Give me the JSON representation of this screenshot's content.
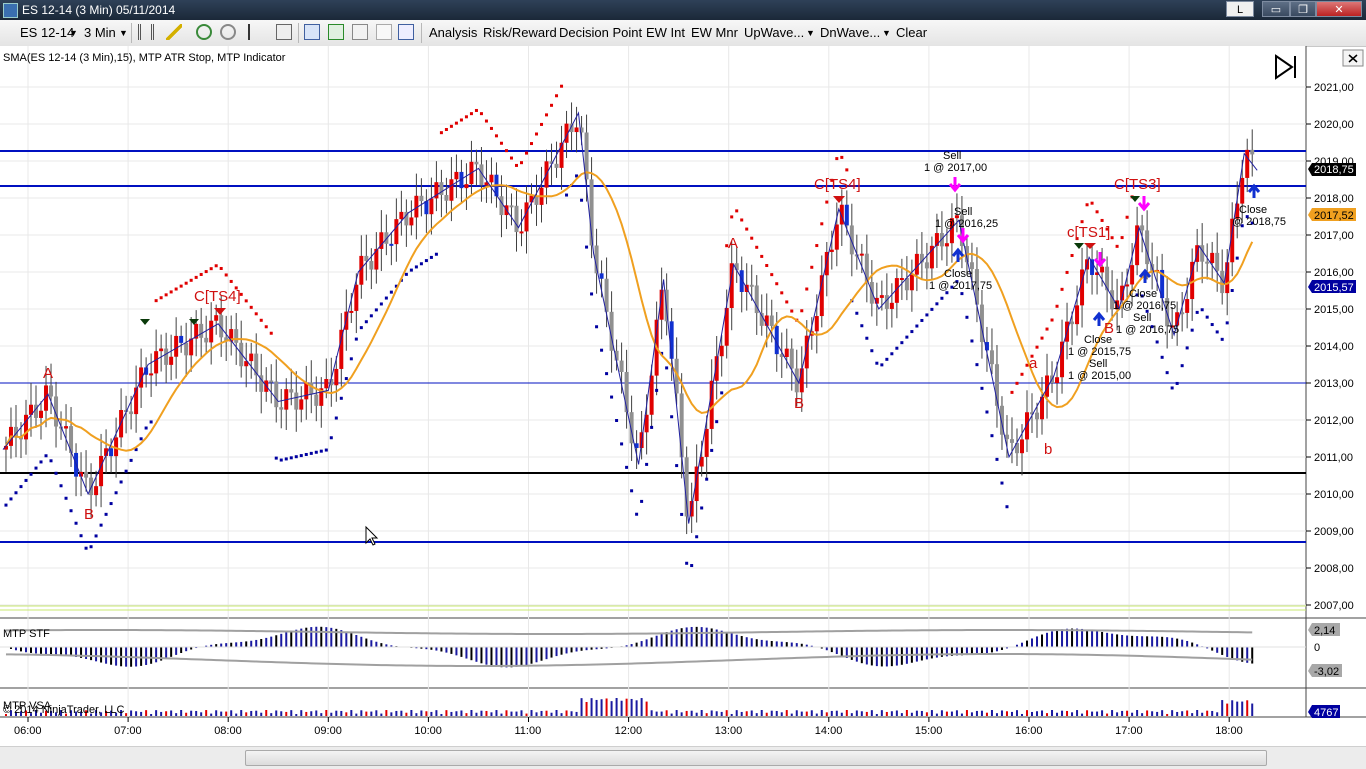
{
  "window": {
    "title": "ES 12-14 (3 Min)  05/11/2014",
    "buttons": {
      "link": "L",
      "minimize": "▭",
      "restore": "❐",
      "close": "✕"
    }
  },
  "toolbar": {
    "instrument": "ES 12-14",
    "interval": "3 Min",
    "items": [
      "Analysis",
      "Risk/Reward",
      "Decision Point",
      "EW Int",
      "EW Mnr",
      "UpWave...",
      "DnWave...",
      "Clear"
    ]
  },
  "indicator_label": "SMA(ES 12-14 (3 Min),15), MTP ATR Stop, MTP Indicator",
  "panels": {
    "stf": "MTP STF",
    "vsa": "MTP VSA"
  },
  "copyright": "© 2014 NinjaTrader, LLC",
  "price_axis": {
    "ticks": [
      "2021,00",
      "2020,00",
      "2019,00",
      "2018,00",
      "2017,00",
      "2016,00",
      "2015,00",
      "2014,00",
      "2013,00",
      "2012,00",
      "2011,00",
      "2010,00",
      "2009,00",
      "2008,00",
      "2007,00"
    ],
    "last_price": "2018,75",
    "sma_value": "2017,52",
    "stop_value": "2015,57"
  },
  "stf_axis": {
    "upper": "2,14",
    "zero": "0",
    "lower": "-3,02"
  },
  "vsa_axis": {
    "value": "4767"
  },
  "time_axis": [
    "06:00",
    "07:00",
    "08:00",
    "09:00",
    "10:00",
    "11:00",
    "12:00",
    "13:00",
    "14:00",
    "15:00",
    "16:00",
    "17:00",
    "18:00"
  ],
  "colors": {
    "up_bar": "#e00000",
    "down_bar": "#808080",
    "sma": "#f0a020",
    "stop_up": "#0000a0",
    "stop_dn": "#e00000",
    "hline": "#0010c0",
    "wave": "#2020a0"
  },
  "annotations": {
    "wave_labels": [
      "A",
      "B",
      "C[TS4]",
      "A",
      "B",
      "C[TS4]",
      "a",
      "b",
      "c[TS1]",
      "C[TS3]"
    ],
    "trades": [
      "Sell",
      "1 @ 2017,00",
      "Sell",
      "1 @ 2016,25",
      "Close",
      "1 @ 2017,75",
      "Close",
      "1 @ 2016,75",
      "Sell",
      "1 @ 2016,75",
      "Close",
      "1 @ 2015,75",
      "Sell",
      "1 @ 2015,00",
      "Close",
      "@ 2018,75"
    ]
  }
}
